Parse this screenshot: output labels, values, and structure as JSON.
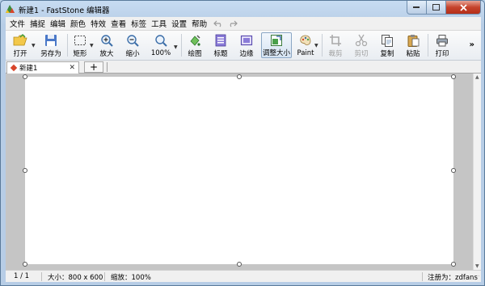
{
  "window": {
    "title": "新建1 - FastStone 编辑器"
  },
  "menu": [
    "文件",
    "捕捉",
    "编辑",
    "颜色",
    "特效",
    "查看",
    "标签",
    "工具",
    "设置",
    "帮助"
  ],
  "toolbar": {
    "open": "打开",
    "save_as": "另存为",
    "rect": "矩形",
    "zoom_in": "放大",
    "zoom_out": "缩小",
    "zoom": "100%",
    "draw": "绘图",
    "caption": "标题",
    "edge": "边缘",
    "resize": "调整大小",
    "paint": "Paint",
    "crop": "裁剪",
    "cut": "剪切",
    "copy": "复制",
    "paste": "粘贴",
    "print": "打印"
  },
  "tabs": {
    "active_label": "新建1",
    "add_label": "+"
  },
  "status": {
    "page": "1 / 1",
    "size": "大小：800 x 600",
    "zoom": "缩放：100%",
    "registered": "注册为：zdfans"
  },
  "colors": {
    "accent": "#d8452a",
    "canvas": "#ffffff",
    "workspace": "#c5c5c5"
  },
  "icons": {
    "open": "folder-open-icon",
    "save_as": "floppy-disk-icon",
    "rect": "rect-select-icon",
    "zoom_in": "magnifier-plus-icon",
    "zoom_out": "magnifier-minus-icon",
    "zoom": "magnifier-icon",
    "draw": "paint-bucket-icon",
    "caption": "caption-icon",
    "edge": "edge-icon",
    "resize": "resize-icon",
    "paint": "palette-icon",
    "crop": "crop-icon",
    "cut": "scissors-icon",
    "copy": "copy-icon",
    "paste": "clipboard-icon",
    "print": "printer-icon"
  }
}
